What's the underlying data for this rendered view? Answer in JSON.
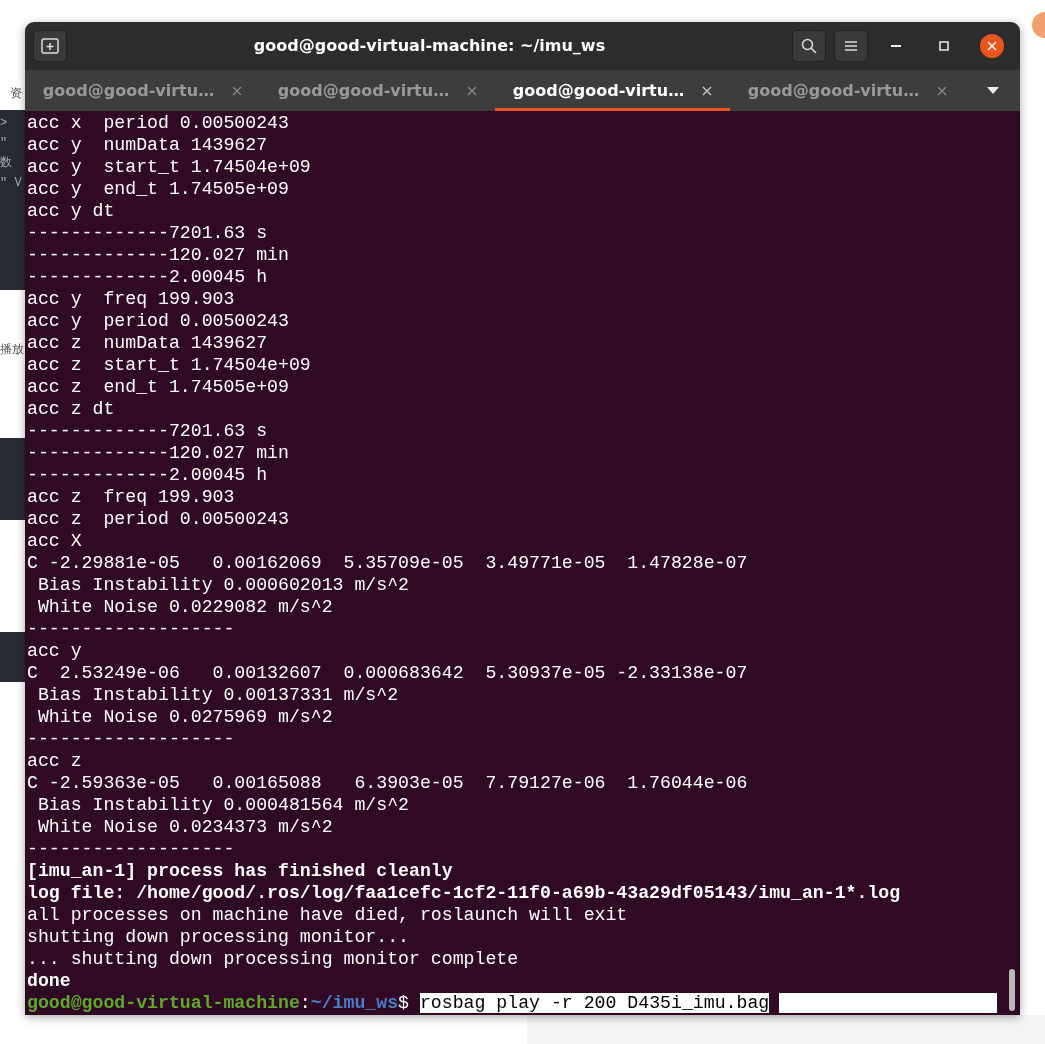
{
  "background": {
    "texts": [
      "资"
    ],
    "code_lines": [
      ">",
      "\"",
      "数",
      "\" V"
    ],
    "heading": "播放"
  },
  "window": {
    "title": "good@good-virtual-machine: ~/imu_ws"
  },
  "tabs": [
    {
      "label": "good@good-virtu…",
      "selected": false
    },
    {
      "label": "good@good-virtu…",
      "selected": false
    },
    {
      "label": "good@good-virtu…",
      "selected": true
    },
    {
      "label": "good@good-virtu…",
      "selected": false
    }
  ],
  "terminal": {
    "lines": [
      {
        "text": "acc x  period 0.00500243",
        "bold": false
      },
      {
        "text": "acc y  numData 1439627",
        "bold": false
      },
      {
        "text": "acc y  start_t 1.74504e+09",
        "bold": false
      },
      {
        "text": "acc y  end_t 1.74505e+09",
        "bold": false
      },
      {
        "text": "acc y dt",
        "bold": false
      },
      {
        "text": "-------------7201.63 s",
        "bold": false
      },
      {
        "text": "-------------120.027 min",
        "bold": false
      },
      {
        "text": "-------------2.00045 h",
        "bold": false
      },
      {
        "text": "acc y  freq 199.903",
        "bold": false
      },
      {
        "text": "acc y  period 0.00500243",
        "bold": false
      },
      {
        "text": "acc z  numData 1439627",
        "bold": false
      },
      {
        "text": "acc z  start_t 1.74504e+09",
        "bold": false
      },
      {
        "text": "acc z  end_t 1.74505e+09",
        "bold": false
      },
      {
        "text": "acc z dt",
        "bold": false
      },
      {
        "text": "-------------7201.63 s",
        "bold": false
      },
      {
        "text": "-------------120.027 min",
        "bold": false
      },
      {
        "text": "-------------2.00045 h",
        "bold": false
      },
      {
        "text": "acc z  freq 199.903",
        "bold": false
      },
      {
        "text": "acc z  period 0.00500243",
        "bold": false
      },
      {
        "text": "acc X",
        "bold": false
      },
      {
        "text": "C -2.29881e-05   0.00162069  5.35709e-05  3.49771e-05  1.47828e-07",
        "bold": false
      },
      {
        "text": " Bias Instability 0.000602013 m/s^2",
        "bold": false
      },
      {
        "text": " White Noise 0.0229082 m/s^2",
        "bold": false
      },
      {
        "text": "-------------------",
        "bold": false
      },
      {
        "text": "acc y",
        "bold": false
      },
      {
        "text": "C  2.53249e-06   0.00132607  0.000683642  5.30937e-05 -2.33138e-07",
        "bold": false
      },
      {
        "text": " Bias Instability 0.00137331 m/s^2",
        "bold": false
      },
      {
        "text": " White Noise 0.0275969 m/s^2",
        "bold": false
      },
      {
        "text": "-------------------",
        "bold": false
      },
      {
        "text": "acc z",
        "bold": false
      },
      {
        "text": "C -2.59363e-05   0.00165088   6.3903e-05  7.79127e-06  1.76044e-06",
        "bold": false
      },
      {
        "text": " Bias Instability 0.000481564 m/s^2",
        "bold": false
      },
      {
        "text": " White Noise 0.0234373 m/s^2",
        "bold": false
      },
      {
        "text": "-------------------",
        "bold": false
      },
      {
        "text": "[imu_an-1] process has finished cleanly",
        "bold": true
      },
      {
        "text": "log file: /home/good/.ros/log/faa1cefc-1cf2-11f0-a69b-43a29df05143/imu_an-1*.log",
        "bold": true
      },
      {
        "text": "all processes on machine have died, roslaunch will exit",
        "bold": false
      },
      {
        "text": "shutting down processing monitor...",
        "bold": false
      },
      {
        "text": "... shutting down processing monitor complete",
        "bold": false
      },
      {
        "text": "done",
        "bold": true
      }
    ],
    "prompt": {
      "user_host": "good@good-virtual-machine",
      "separator": ":",
      "path": "~/imu_ws",
      "symbol": "$",
      "command": "rosbag play -r 200 D435i_imu.bag",
      "selected": true
    }
  }
}
